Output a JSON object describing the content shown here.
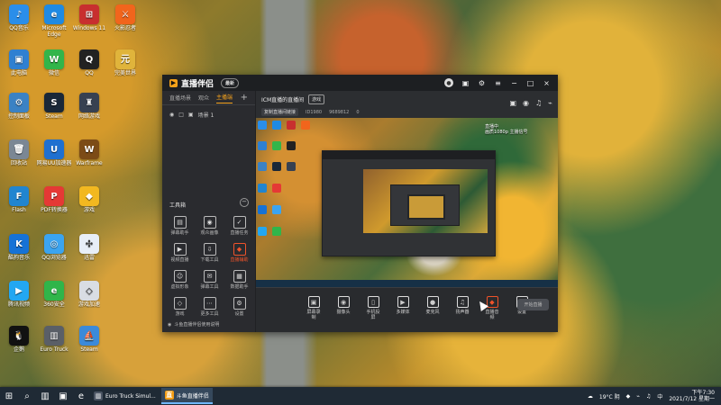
{
  "desktop": {
    "icons": [
      {
        "label": "QQ音乐",
        "glyph": "♪",
        "bg": "#2a8eea"
      },
      {
        "label": "Microsoft Edge",
        "glyph": "e",
        "bg": "#1f8ae3"
      },
      {
        "label": "Windows 11",
        "glyph": "⊞",
        "bg": "#c82f2f"
      },
      {
        "label": "火影忍者",
        "glyph": "⚔",
        "bg": "#f1651c"
      },
      {
        "label": "此电脑",
        "glyph": "▣",
        "bg": "#2f80d1"
      },
      {
        "label": "微信",
        "glyph": "W",
        "bg": "#32b54a"
      },
      {
        "label": "QQ",
        "glyph": "Q",
        "bg": "#222222"
      },
      {
        "label": "完美世界",
        "glyph": "元",
        "bg": "#e0b43b"
      },
      {
        "label": "控制面板",
        "glyph": "⚙",
        "bg": "#3b82c4"
      },
      {
        "label": "Steam",
        "glyph": "S",
        "bg": "#1a2838"
      },
      {
        "label": "网络游戏",
        "glyph": "♜",
        "bg": "#374151"
      },
      {
        "label": "回收站",
        "glyph": "🗑",
        "bg": "#7b8794"
      },
      {
        "label": "网易UU加速器",
        "glyph": "U",
        "bg": "#1f70d0"
      },
      {
        "label": "Warframe",
        "glyph": "W",
        "bg": "#7c4b16"
      },
      {
        "label": "Flash",
        "glyph": "F",
        "bg": "#2185d0"
      },
      {
        "label": "PDF转换器",
        "glyph": "P",
        "bg": "#e53935"
      },
      {
        "label": "游戏",
        "glyph": "◆",
        "bg": "#f2b820"
      },
      {
        "label": "酷狗音乐",
        "glyph": "K",
        "bg": "#1672d6"
      },
      {
        "label": "QQ浏览器",
        "glyph": "◎",
        "bg": "#3ba4f0"
      },
      {
        "label": "迅雷",
        "glyph": "✣",
        "bg": "#e8eef7"
      },
      {
        "label": "腾讯视频",
        "glyph": "▶",
        "bg": "#23a7f2"
      },
      {
        "label": "360安全",
        "glyph": "e",
        "bg": "#30b54a"
      },
      {
        "label": "游戏加速",
        "glyph": "◇",
        "bg": "#d9dde3"
      },
      {
        "label": "企鹅",
        "glyph": "🐧",
        "bg": "#111111"
      },
      {
        "label": "Euro Truck",
        "glyph": "▥",
        "bg": "#5a5f67"
      },
      {
        "label": "Steam",
        "glyph": "⛵",
        "bg": "#3b8ad9"
      }
    ]
  },
  "app": {
    "name": "直播伴侣",
    "version": "最新",
    "sidebar": {
      "tabs": [
        "直播场景",
        "观众",
        "主播端"
      ],
      "active_tab": "主播端",
      "add": "+",
      "scene": "场景 1",
      "toolbox_title": "工具箱",
      "collapse": "−",
      "tools": [
        {
          "label": "弹幕助手",
          "icon": "▤"
        },
        {
          "label": "观众画像",
          "icon": "◉"
        },
        {
          "label": "直播任务",
          "icon": "✓"
        },
        {
          "label": "视频直播",
          "icon": "▶"
        },
        {
          "label": "下载工具",
          "icon": "⇩"
        },
        {
          "label": "直播辅助",
          "icon": "◆",
          "active": true
        },
        {
          "label": "虚拟形象",
          "icon": "☺"
        },
        {
          "label": "弹幕工具",
          "icon": "✉"
        },
        {
          "label": "数据助手",
          "icon": "▦"
        },
        {
          "label": "游戏",
          "icon": "◇"
        },
        {
          "label": "更多工具",
          "icon": "⋯"
        },
        {
          "label": "设置",
          "icon": "⚙"
        }
      ],
      "footer": "斗鱼直播伴侣使用说明"
    },
    "header": {
      "room_title": "ICM直播的直播间",
      "room_badge": "游戏",
      "link_text": "复制直播间链接",
      "meta_1": "ID1980",
      "meta_2": "9689812",
      "meta_3": "0"
    },
    "preview": {
      "label_1": "直播中",
      "label_2": "画质1080p 主播信号"
    },
    "controls": [
      {
        "label": "屏幕录制",
        "icon": "▣"
      },
      {
        "label": "摄像头",
        "icon": "◉"
      },
      {
        "label": "手机投屏",
        "icon": "▯"
      },
      {
        "label": "多媒体",
        "icon": "▶"
      },
      {
        "label": "麦克风",
        "icon": "●"
      },
      {
        "label": "扬声器",
        "icon": "♫"
      },
      {
        "label": "直播音频",
        "icon": "◆",
        "active": true
      },
      {
        "label": "设置",
        "icon": "⚙"
      }
    ],
    "start_live": "开始直播"
  },
  "taskbar": {
    "apps": [
      {
        "label": "Euro Truck Simul...",
        "glyph": "▥",
        "bg": "#4b5563"
      },
      {
        "label": "斗鱼直播伴侣",
        "glyph": "直",
        "bg": "#f39c12",
        "active": true
      }
    ],
    "weather": "19°C 阴",
    "time": "下午7:30",
    "date": "2021/7/12 星期一"
  }
}
